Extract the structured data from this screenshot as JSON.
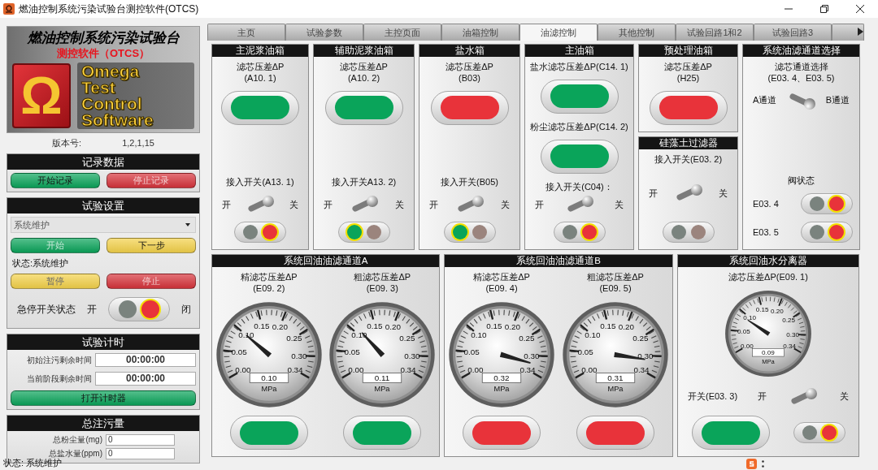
{
  "window": {
    "title": "燃油控制系统污染试验台测控软件(OTCS)"
  },
  "logo": {
    "title": "燃油控制系统污染试验台",
    "subtitle": "测控软件（OTCS）",
    "emblem": "Ω",
    "wordmark": [
      "Omega",
      "Test",
      "Control",
      "Software"
    ]
  },
  "version": {
    "label": "版本号:",
    "value": "1,2,1,15"
  },
  "record": {
    "title": "记录数据",
    "buttons": [
      {
        "label": "开始记录",
        "color": "#0aa45a",
        "disabled": false
      },
      {
        "label": "停止记录",
        "color": "#d7333b",
        "disabled": true
      }
    ]
  },
  "settings": {
    "title": "试验设置",
    "select": {
      "value": "系统维护"
    },
    "buttons": [
      {
        "label": "开始",
        "color": "#0aa45a",
        "disabled": true
      },
      {
        "label": "下一步",
        "color": "#f4d24a",
        "disabled": false
      }
    ],
    "status": "状态:系统维护",
    "buttons2": [
      {
        "label": "暂停",
        "color": "#f4d24a",
        "disabled": true
      },
      {
        "label": "停止",
        "color": "#d7333b",
        "disabled": true
      }
    ],
    "estop": {
      "label": "急停开关状态",
      "on_label": "开",
      "off_label": "闭",
      "lamps": [
        {
          "color": "#7a837e",
          "lit": false
        },
        {
          "color": "#e8333a",
          "lit": true
        }
      ]
    }
  },
  "timer": {
    "title": "试验计时",
    "rows": [
      {
        "label": "初始注污剩余时间",
        "value": "00:00:00"
      },
      {
        "label": "当前阶段剩余时间",
        "value": "00:00:00"
      }
    ],
    "button": {
      "label": "打开计时器",
      "color": "#0aa45a",
      "disabled": false
    }
  },
  "totals": {
    "title": "总注污量",
    "rows": [
      {
        "label": "总粉尘量(mg)",
        "value": "0"
      },
      {
        "label": "总盐水量(ppm)",
        "value": "0"
      }
    ]
  },
  "tabs": [
    {
      "label": "主页",
      "selected": false
    },
    {
      "label": "试验参数",
      "selected": false
    },
    {
      "label": "主控页面",
      "selected": false
    },
    {
      "label": "油箱控制",
      "selected": false
    },
    {
      "label": "油滤控制",
      "selected": true
    },
    {
      "label": "其他控制",
      "selected": false
    },
    {
      "label": "试验回路1和2",
      "selected": false
    },
    {
      "label": "试验回路3",
      "selected": false
    }
  ],
  "top_row": [
    {
      "panels": [
        {
          "title": "主泥浆油箱",
          "columns": [
            {
              "groups": [
                [
                  {
                    "kind": "label",
                    "lines": [
                      "滤芯压差ΔP",
                      "(A10. 1)"
                    ]
                  },
                  {
                    "kind": "indicator",
                    "color": "#0aa45a"
                  }
                ],
                [
                  {
                    "kind": "label",
                    "lines": [
                      "接入开关(A13. 1)"
                    ]
                  },
                  {
                    "kind": "switch",
                    "on_label": "开",
                    "off_label": "关",
                    "on": false
                  },
                  {
                    "kind": "lamps",
                    "lamps": [
                      {
                        "color": "#7a837e",
                        "lit": false
                      },
                      {
                        "color": "#e8333a",
                        "lit": true
                      }
                    ]
                  }
                ]
              ]
            }
          ]
        }
      ]
    },
    {
      "panels": [
        {
          "title": "辅助泥浆油箱",
          "columns": [
            {
              "groups": [
                [
                  {
                    "kind": "label",
                    "lines": [
                      "滤芯压差ΔP",
                      "(A10. 2)"
                    ]
                  },
                  {
                    "kind": "indicator",
                    "color": "#0aa45a"
                  }
                ],
                [
                  {
                    "kind": "label",
                    "lines": [
                      "接入开关A13. 2)"
                    ]
                  },
                  {
                    "kind": "switch",
                    "on_label": "开",
                    "off_label": "关",
                    "on": false
                  },
                  {
                    "kind": "lamps",
                    "lamps": [
                      {
                        "color": "#0aa45a",
                        "lit": true
                      },
                      {
                        "color": "#9b847d",
                        "lit": false
                      }
                    ]
                  }
                ]
              ]
            }
          ]
        }
      ]
    },
    {
      "panels": [
        {
          "title": "盐水箱",
          "columns": [
            {
              "groups": [
                [
                  {
                    "kind": "label",
                    "lines": [
                      "滤芯压差ΔP",
                      "(B03)"
                    ]
                  },
                  {
                    "kind": "indicator",
                    "color": "#e8333a"
                  }
                ],
                [
                  {
                    "kind": "label",
                    "lines": [
                      "接入开关(B05)"
                    ]
                  },
                  {
                    "kind": "switch",
                    "on_label": "开",
                    "off_label": "关",
                    "on": false
                  },
                  {
                    "kind": "lamps",
                    "lamps": [
                      {
                        "color": "#0aa45a",
                        "lit": true
                      },
                      {
                        "color": "#9b847d",
                        "lit": false
                      }
                    ]
                  }
                ]
              ]
            }
          ]
        }
      ]
    },
    {
      "panels": [
        {
          "title": "主油箱",
          "columns": [
            {
              "groups": [
                [
                  {
                    "kind": "label",
                    "lines": [
                      "盐水滤芯压差ΔP(C14. 1)"
                    ]
                  },
                  {
                    "kind": "indicator",
                    "color": "#0aa45a"
                  },
                  {
                    "kind": "label",
                    "lines": [
                      "粉尘滤芯压差ΔP(C14. 2)"
                    ]
                  },
                  {
                    "kind": "indicator",
                    "color": "#0aa45a"
                  },
                  {
                    "kind": "label",
                    "lines": [
                      "接入开关(C04)："
                    ]
                  }
                ],
                [
                  {
                    "kind": "switch",
                    "on_label": "开",
                    "off_label": "关",
                    "on": false
                  },
                  {
                    "kind": "lamps",
                    "lamps": [
                      {
                        "color": "#7a837e",
                        "lit": false
                      },
                      {
                        "color": "#e8333a",
                        "lit": true
                      }
                    ]
                  }
                ]
              ]
            }
          ]
        }
      ]
    },
    {
      "panels": [
        {
          "title": "预处理油箱",
          "columns": [
            {
              "groups": [
                [
                  {
                    "kind": "label",
                    "lines": [
                      "滤芯压差ΔP",
                      "(H25)"
                    ]
                  },
                  {
                    "kind": "indicator",
                    "color": "#e8333a"
                  }
                ]
              ]
            }
          ]
        },
        {
          "title": "硅藻土过滤器",
          "columns": [
            {
              "groups": [
                [
                  {
                    "kind": "label",
                    "lines": [
                      "接入开关(E03. 2)"
                    ]
                  }
                ],
                [
                  {
                    "kind": "switch",
                    "on_label": "开",
                    "off_label": "关",
                    "on": false
                  }
                ],
                [
                  {
                    "kind": "lamps",
                    "lamps": [
                      {
                        "color": "#7a837e",
                        "lit": false
                      },
                      {
                        "color": "#9b847d",
                        "lit": false
                      }
                    ]
                  }
                ]
              ]
            }
          ]
        }
      ]
    },
    {
      "panels": [
        {
          "title": "系统油滤通道选择",
          "columns": [
            {
              "groups": [
                [
                  {
                    "kind": "label",
                    "lines": [
                      "滤芯通道选择",
                      "(E03. 4、E03. 5)"
                    ]
                  },
                  {
                    "kind": "switch",
                    "on_label": "A通道",
                    "off_label": "B通道",
                    "on": true
                  }
                ],
                [
                  {
                    "kind": "label",
                    "lines": [
                      "阀状态"
                    ]
                  },
                  {
                    "kind": "lamps",
                    "label": "E03. 4",
                    "lamps": [
                      {
                        "color": "#7a837e",
                        "lit": false
                      },
                      {
                        "color": "#e8333a",
                        "lit": true
                      }
                    ]
                  },
                  {
                    "kind": "lamps",
                    "label": "E03. 5",
                    "lamps": [
                      {
                        "color": "#7a837e",
                        "lit": false
                      },
                      {
                        "color": "#e8333a",
                        "lit": true
                      }
                    ]
                  }
                ]
              ]
            }
          ]
        }
      ]
    }
  ],
  "bottom_row": [
    {
      "title": "系统回油油滤通道A",
      "columns": [
        {
          "groups": [
            [
              {
                "kind": "label",
                "lines": [
                  "精滤芯压差ΔP",
                  "(E09. 2)"
                ]
              },
              {
                "kind": "gauge",
                "ticks": [
                  "0.15",
                  "0.20",
                  "0.10",
                  "0.25",
                  "0.05",
                  "0.30",
                  "0.00",
                  "0.34"
                ],
                "reading": "0.10",
                "unit": "MPa"
              }
            ],
            [
              {
                "kind": "indicator",
                "color": "#0aa45a"
              }
            ]
          ]
        },
        {
          "groups": [
            [
              {
                "kind": "label",
                "lines": [
                  "粗滤芯压差ΔP",
                  "(E09. 3)"
                ]
              },
              {
                "kind": "gauge",
                "ticks": [
                  "0.15",
                  "0.20",
                  "0.10",
                  "0.25",
                  "0.05",
                  "0.30",
                  "0.00",
                  "0.34"
                ],
                "reading": "0.11",
                "unit": "MPa"
              }
            ],
            [
              {
                "kind": "indicator",
                "color": "#0aa45a"
              }
            ]
          ]
        }
      ]
    },
    {
      "title": "系统回油油滤通道B",
      "columns": [
        {
          "groups": [
            [
              {
                "kind": "label",
                "lines": [
                  "精滤芯压差ΔP",
                  "(E09. 4)"
                ]
              },
              {
                "kind": "gauge",
                "ticks": [
                  "0.15",
                  "0.20",
                  "0.10",
                  "0.25",
                  "0.05",
                  "0.30",
                  "0.00",
                  "0.34"
                ],
                "reading": "0.32",
                "unit": "MPa"
              }
            ],
            [
              {
                "kind": "indicator",
                "color": "#e8333a"
              }
            ]
          ]
        },
        {
          "groups": [
            [
              {
                "kind": "label",
                "lines": [
                  "粗滤芯压差ΔP",
                  "(E09. 5)"
                ]
              },
              {
                "kind": "gauge",
                "ticks": [
                  "0.15",
                  "0.20",
                  "0.10",
                  "0.25",
                  "0.05",
                  "0.30",
                  "0.00",
                  "0.34"
                ],
                "reading": "0.31",
                "unit": "MPa"
              }
            ],
            [
              {
                "kind": "indicator",
                "color": "#e8333a"
              }
            ]
          ]
        }
      ]
    },
    {
      "title": "系统回油水分离器",
      "columns": [
        {
          "groups": [
            [
              {
                "kind": "label",
                "lines": [
                  "滤芯压差ΔP(E09. 1)"
                ]
              },
              {
                "kind": "gauge",
                "ticks": [
                  "0.15",
                  "0.20",
                  "0.10",
                  "0.25",
                  "0.05",
                  "0.30",
                  "0.00",
                  "0.34"
                ],
                "reading": "0.09",
                "unit": "MPa"
              }
            ],
            [
              {
                "kind": "switch",
                "label": "开关(E03. 3)",
                "on_label": "开",
                "off_label": "关",
                "on": false
              }
            ],
            [
              {
                "kind": "row",
                "items": [
                  {
                    "kind": "indicator",
                    "color": "#0aa45a"
                  },
                  {
                    "kind": "lamps",
                    "lamps": [
                      {
                        "color": "#7a837e",
                        "lit": false
                      },
                      {
                        "color": "#e8333a",
                        "lit": true
                      }
                    ]
                  }
                ]
              }
            ]
          ]
        }
      ]
    }
  ],
  "status_bar": {
    "text": "状态: 系统维护"
  }
}
